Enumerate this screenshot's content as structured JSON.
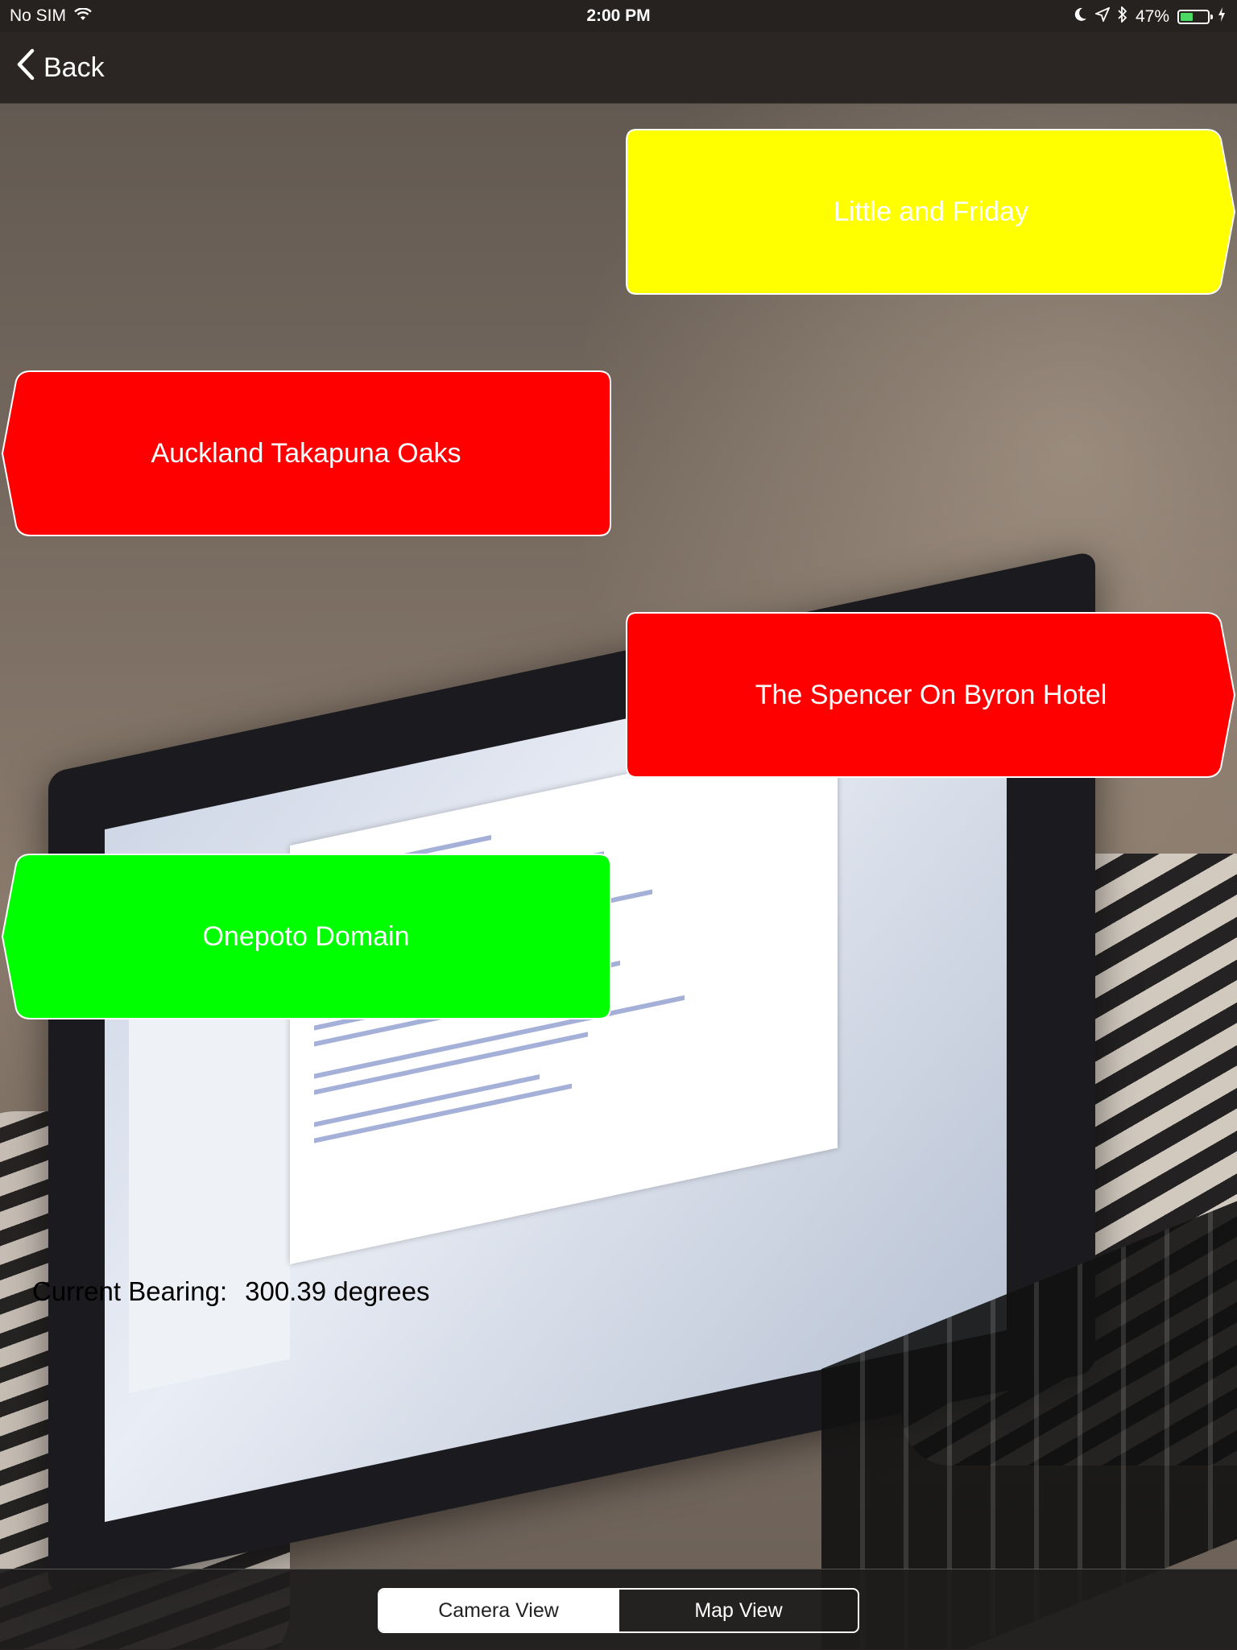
{
  "status_bar": {
    "carrier": "No SIM",
    "time": "2:00 PM",
    "battery_percent": "47%",
    "battery_level": 0.47
  },
  "nav": {
    "back_label": "Back"
  },
  "ar_labels": [
    {
      "text": "Little and Friday",
      "color": "#ffff00",
      "direction": "right"
    },
    {
      "text": "Auckland Takapuna Oaks",
      "color": "#ff0000",
      "direction": "left"
    },
    {
      "text": "The Spencer On Byron Hotel",
      "color": "#ff0000",
      "direction": "right"
    },
    {
      "text": "Onepoto Domain",
      "color": "#00ff00",
      "direction": "left"
    }
  ],
  "bearing": {
    "label": "Current Bearing:",
    "value": "300.39 degrees"
  },
  "segmented_control": {
    "options": [
      "Camera View",
      "Map View"
    ],
    "selected": "Camera View"
  }
}
